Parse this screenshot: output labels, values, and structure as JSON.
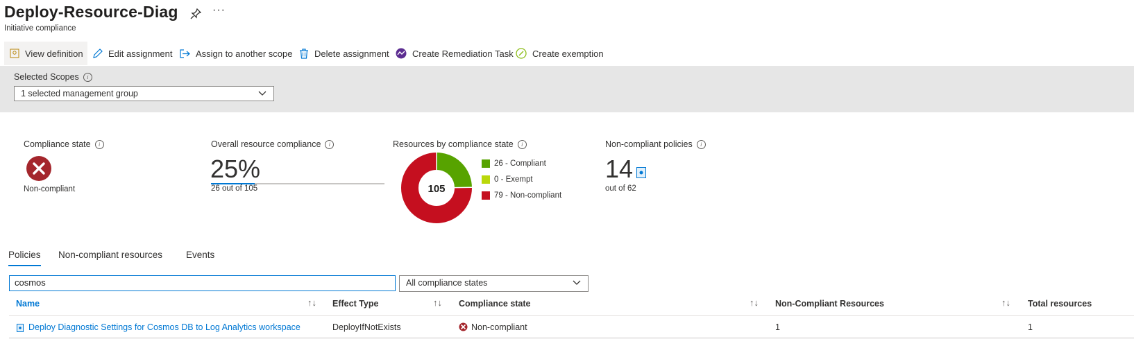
{
  "header": {
    "title": "Deploy-Resource-Diag",
    "subtitle": "Initiative compliance",
    "more_label": "···"
  },
  "toolbar": {
    "items": [
      {
        "label": "View definition",
        "icon": "view-definition-icon"
      },
      {
        "label": "Edit assignment",
        "icon": "pencil-icon"
      },
      {
        "label": "Assign to another scope",
        "icon": "assign-scope-icon"
      },
      {
        "label": "Delete assignment",
        "icon": "trash-icon"
      },
      {
        "label": "Create Remediation Task",
        "icon": "remediation-icon"
      },
      {
        "label": "Create exemption",
        "icon": "exemption-icon"
      }
    ]
  },
  "scope": {
    "label": "Selected Scopes",
    "value": "1 selected management group"
  },
  "metrics": {
    "compliance_state": {
      "label": "Compliance state",
      "value": "Non-compliant"
    },
    "overall": {
      "label": "Overall resource compliance",
      "percent": "25%",
      "detail": "26 out of 105",
      "fraction": 0.25
    },
    "by_state": {
      "label": "Resources by compliance state",
      "total": "105",
      "legend": [
        {
          "label": "26 - Compliant",
          "value": 26,
          "color": "#57a300"
        },
        {
          "label": "0 - Exempt",
          "value": 0,
          "color": "#bad80a"
        },
        {
          "label": "79 - Non-compliant",
          "value": 79,
          "color": "#c50f1f"
        }
      ]
    },
    "noncompliant_policies": {
      "label": "Non-compliant policies",
      "value": "14",
      "detail": "out of 62"
    }
  },
  "tabs": [
    {
      "label": "Policies"
    },
    {
      "label": "Non-compliant resources"
    },
    {
      "label": "Events"
    }
  ],
  "filters": {
    "search_value": "cosmos",
    "state_value": "All compliance states"
  },
  "table": {
    "columns": [
      "Name",
      "Effect Type",
      "Compliance state",
      "Non-Compliant Resources",
      "Total resources"
    ],
    "sort_glyph": "↑↓",
    "rows": [
      {
        "name": "Deploy Diagnostic Settings for Cosmos DB to Log Analytics workspace",
        "effect": "DeployIfNotExists",
        "state": "Non-compliant",
        "noncompliant": "1",
        "total": "1"
      }
    ]
  }
}
